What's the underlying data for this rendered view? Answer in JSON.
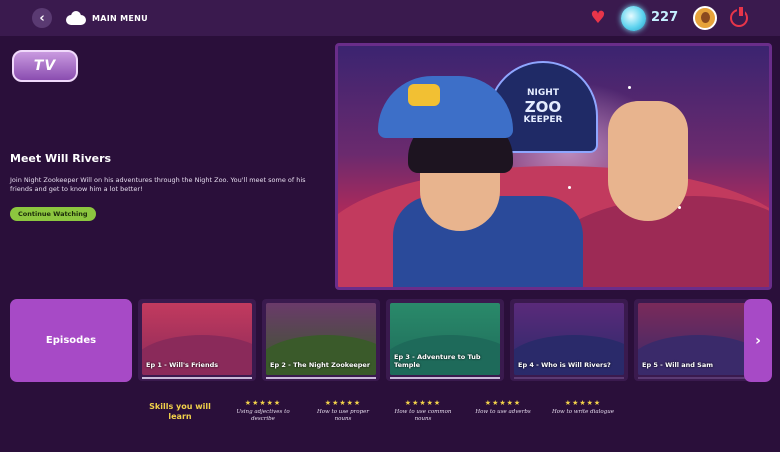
{
  "header": {
    "back_label": "‹",
    "menu_label": "MAIN MENU",
    "coin_count": "227"
  },
  "logo": {
    "text": "TV"
  },
  "hero": {
    "title": "Meet Will Rivers",
    "description": "Join Night Zookeeper Will on his adventures through the Night Zoo. You'll meet some of his friends and get to know him a lot better!",
    "cta_label": "Continue Watching",
    "show_logo": {
      "line1": "NIGHT",
      "line2": "ZOO",
      "line3": "KEEPER"
    }
  },
  "episodes": {
    "button_label": "Episodes",
    "next_label": "›",
    "items": [
      {
        "label": "Ep 1 - Will's Friends",
        "progress": 1.0,
        "colors": [
          "#8a2a5a",
          "#c23a5e"
        ]
      },
      {
        "label": "Ep 2 - The Night Zookeeper",
        "progress": 1.0,
        "colors": [
          "#3a5a2a",
          "#6a3a6a"
        ]
      },
      {
        "label": "Ep 3 - Adventure to Tub Temple",
        "progress": 1.0,
        "colors": [
          "#1e6a5a",
          "#2a8a6a"
        ]
      },
      {
        "label": "Ep 4 - Who is Will Rivers?",
        "progress": 0.0,
        "colors": [
          "#2a2a6a",
          "#5a2a7a"
        ]
      },
      {
        "label": "Ep 5 - Will and Sam",
        "progress": 0.0,
        "colors": [
          "#3a2a6a",
          "#7a2a5a"
        ]
      }
    ]
  },
  "skills": {
    "title": "Skills you will learn",
    "items": [
      {
        "stars": "★★★★★",
        "label": "Using adjectives to describe"
      },
      {
        "stars": "★★★★★",
        "label": "How to use proper nouns"
      },
      {
        "stars": "★★★★★",
        "label": "How to use common nouns"
      },
      {
        "stars": "★★★★★",
        "label": "How to use adverbs"
      },
      {
        "stars": "★★★★★",
        "label": "How to write dialogue"
      }
    ]
  },
  "icons": {
    "back": "chevron-left-icon",
    "menu": "cloud-icon",
    "heart": "heart-icon",
    "gem": "gem-icon",
    "avatar": "avatar",
    "power": "power-icon"
  },
  "colors": {
    "background": "#2a0f3a",
    "topbar": "#3a1a4e",
    "accent_purple": "#a74ac6",
    "cta_green": "#8cc63f",
    "star_yellow": "#f2d24a",
    "heart_red": "#e8354a"
  }
}
